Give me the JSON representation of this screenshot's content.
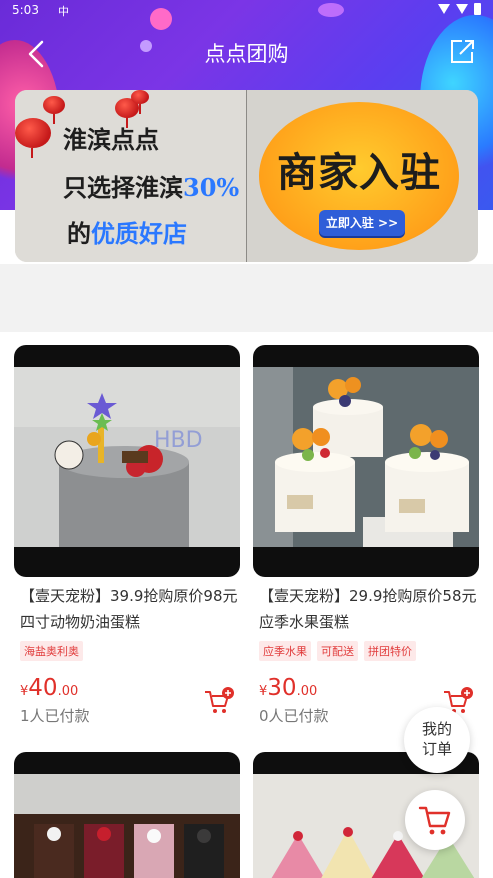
{
  "status_bar": {
    "time": "5:03",
    "sim_label": "中"
  },
  "header": {
    "title": "点点团购"
  },
  "banner": {
    "line1": "淮滨点点",
    "line2_prefix": "只选择淮滨",
    "line2_highlight": "30%",
    "line3_prefix": "的",
    "line3_highlight": "优质好店",
    "badge_title": "商家入驻",
    "badge_button": "立即入驻 >>"
  },
  "products": [
    {
      "name": "【壹天宠粉】39.9抢购原价98元四寸动物奶油蛋糕",
      "tags": [
        "海盐奥利奥"
      ],
      "currency": "¥",
      "price_int": "40",
      "price_dec": ".00",
      "sold": "1人已付款"
    },
    {
      "name": "【壹天宠粉】29.9抢购原价58元应季水果蛋糕",
      "tags": [
        "应季水果",
        "可配送",
        "拼团特价"
      ],
      "currency": "¥",
      "price_int": "30",
      "price_dec": ".00",
      "sold": "0人已付款"
    }
  ],
  "fab": {
    "orders_line1": "我的",
    "orders_line2": "订单"
  },
  "colors": {
    "accent": "#e0302a",
    "header_start": "#6a2bd8",
    "header_end": "#3a59f0",
    "tag_bg": "#fde9e9"
  },
  "icons": {
    "back": "chevron-left-icon",
    "share": "share-icon",
    "add_to_cart": "cart-plus-icon",
    "cart": "cart-icon"
  }
}
